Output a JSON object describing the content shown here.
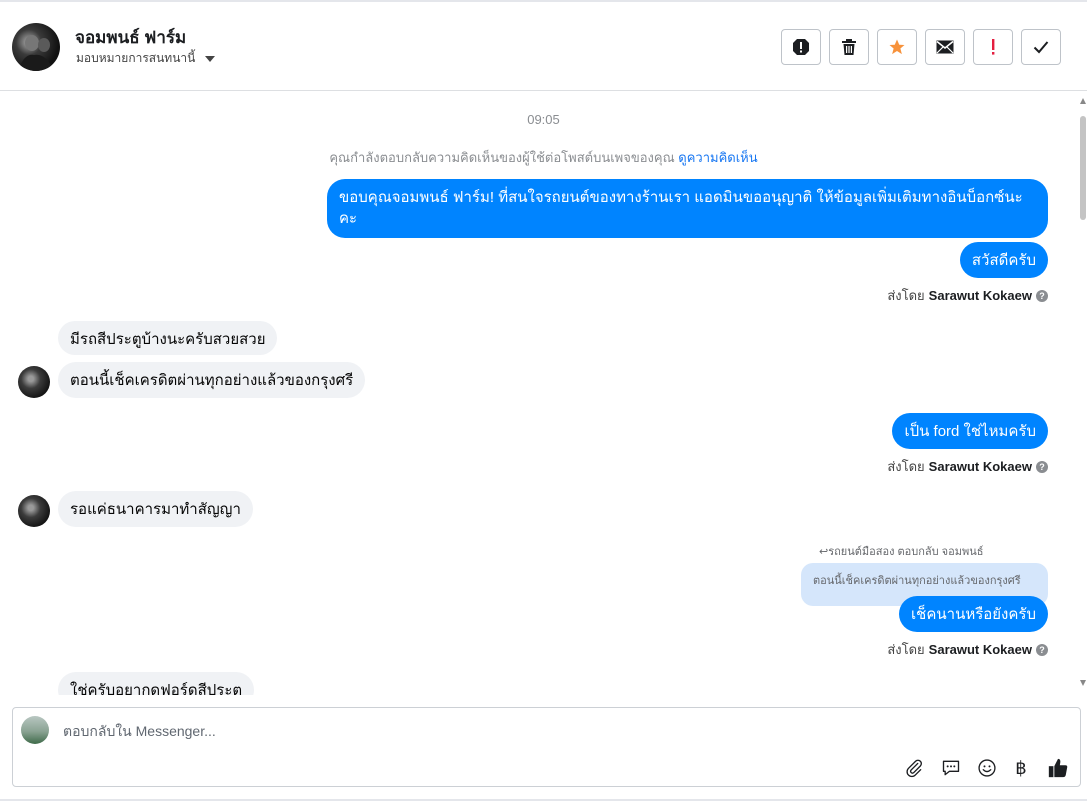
{
  "header": {
    "contact_name": "จอมพนธ์ ฟาร์ม",
    "assign_label": "มอบหมายการสนทนานี้",
    "actions": [
      {
        "name": "spam-icon"
      },
      {
        "name": "trash-icon"
      },
      {
        "name": "star-icon",
        "color": "#f7923b"
      },
      {
        "name": "mail-icon"
      },
      {
        "name": "important-icon",
        "color": "#e41e3f"
      },
      {
        "name": "check-icon"
      }
    ]
  },
  "chat": {
    "timestamp": "09:05",
    "reply_note": "คุณกำลังตอบกลับความคิดเห็นของผู้ใช้ต่อโพสต์บนเพจของคุณ",
    "reply_note_link": "ดูความคิดเห็น",
    "messages": [
      {
        "dir": "out",
        "text": "ขอบคุณจอมพนธ์ ฟาร์ม! ที่สนใจรถยนต์ของทางร้านเรา แอดมินขออนุญาติ ให้ข้อมูลเพิ่มเติมทางอินบ็อกซ์นะคะ"
      },
      {
        "dir": "out",
        "text": "สวัสดีครับ"
      },
      {
        "dir": "in",
        "text": "มีรถสีประตูบ้างนะครับสวยสวย"
      },
      {
        "dir": "in",
        "text": "ตอนนี้เช็คเครดิตผ่านทุกอย่างแล้วของกรุงศรี"
      },
      {
        "dir": "out",
        "text": "เป็น ford ใช่ไหมครับ"
      },
      {
        "dir": "in",
        "text": "รอแค่ธนาคารมาทำสัญญา"
      },
      {
        "dir": "out",
        "text": "เช็คนานหรือยังครับ"
      },
      {
        "dir": "in",
        "text": "ใช่ครับอยากดฟอร์ดสีประต"
      }
    ],
    "sent_by_prefix": "ส่งโดย",
    "sent_by_name": "Sarawut Kokaew",
    "help_mark": "?",
    "quote_label": "รถยนต์มือสอง ตอบกลับ จอมพนธ์",
    "quote_text": "ตอนนี้เช็คเครดิตผ่านทุกอย่างแล้วของกรุงศรี"
  },
  "composer": {
    "placeholder": "ตอบกลับใน Messenger...",
    "icons": [
      "paperclip-icon",
      "saved-reply-icon",
      "emoji-icon",
      "baht-icon",
      "thumbs-up-icon"
    ],
    "baht_glyph": "฿"
  }
}
